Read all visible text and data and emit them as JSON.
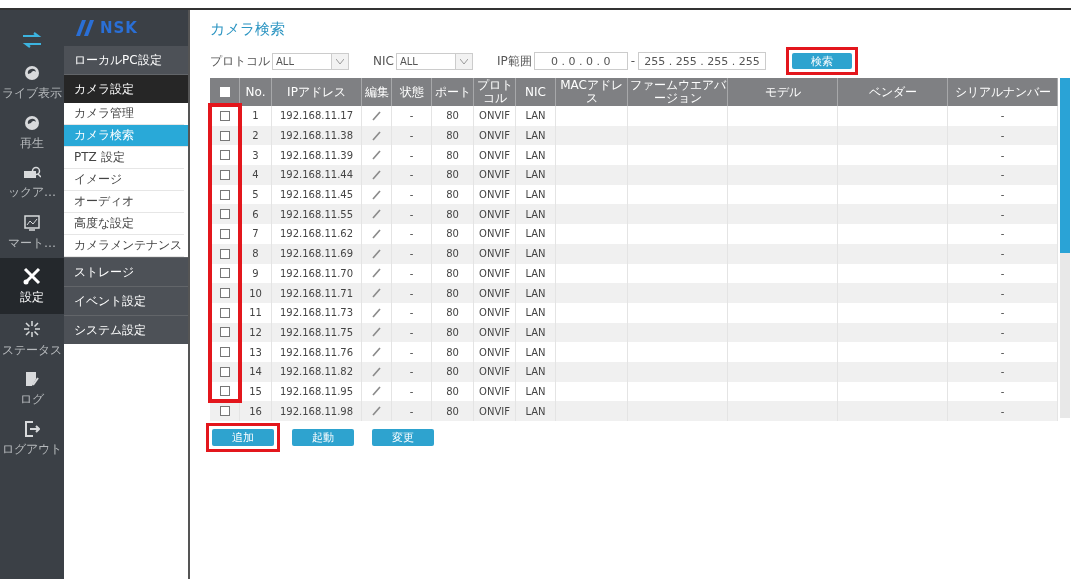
{
  "nav_bar": [
    {
      "selected": false
    },
    {
      "label": "ライブ表示",
      "selected": false
    },
    {
      "label": "再生",
      "selected": false
    },
    {
      "label": "ックア…",
      "selected": false
    },
    {
      "label": "マート…",
      "selected": false
    },
    {
      "label": "設定",
      "selected": true
    },
    {
      "label": "ステータス",
      "selected": false
    },
    {
      "label": "ログ",
      "selected": false
    },
    {
      "label": "ログアウト",
      "selected": false
    }
  ],
  "logo": {
    "text": "NSK"
  },
  "menu": [
    {
      "label": "ローカルPC設定",
      "selected": false
    },
    {
      "label": "カメラ設定",
      "selected": true,
      "children": [
        {
          "label": "カメラ管理",
          "selected": false
        },
        {
          "label": "カメラ検索",
          "selected": true
        },
        {
          "label": "PTZ 設定",
          "selected": false
        },
        {
          "label": "イメージ",
          "selected": false
        },
        {
          "label": "オーディオ",
          "selected": false
        },
        {
          "label": "高度な設定",
          "selected": false
        },
        {
          "label": "カメラメンテナンス",
          "selected": false
        }
      ]
    },
    {
      "label": "ストレージ",
      "selected": false
    },
    {
      "label": "イベント設定",
      "selected": false
    },
    {
      "label": "システム設定",
      "selected": false
    }
  ],
  "page_title": "カメラ検索",
  "filters": {
    "protocol_label": "プロトコル",
    "protocol": "ALL",
    "nic_label": "NIC",
    "nic": "ALL",
    "ip_label": "IP範囲",
    "ip_start": "0 . 0 . 0 . 0",
    "ip_separator": "-",
    "ip_end": "255 . 255 . 255 . 255"
  },
  "search_button": {
    "label": "検索",
    "highlighted": true
  },
  "table": {
    "checkbox_column_highlighted": true,
    "select_all_checked": false,
    "columns": [
      "No.",
      "IPアドレス",
      "編集",
      "状態",
      "ポート",
      "プロトコル",
      "NIC",
      "MACアドレス",
      "ファームウエアバージョン",
      "モデル",
      "ベンダー",
      "シリアルナンバー"
    ],
    "rows": [
      {
        "checked": false,
        "no": "1",
        "ip": "192.168.11.17",
        "status": "-",
        "port": "80",
        "protocol": "ONVIF",
        "nic": "LAN",
        "serial": "-"
      },
      {
        "checked": false,
        "no": "2",
        "ip": "192.168.11.38",
        "status": "-",
        "port": "80",
        "protocol": "ONVIF",
        "nic": "LAN",
        "serial": "-"
      },
      {
        "checked": false,
        "no": "3",
        "ip": "192.168.11.39",
        "status": "-",
        "port": "80",
        "protocol": "ONVIF",
        "nic": "LAN",
        "serial": "-"
      },
      {
        "checked": false,
        "no": "4",
        "ip": "192.168.11.44",
        "status": "-",
        "port": "80",
        "protocol": "ONVIF",
        "nic": "LAN",
        "serial": "-"
      },
      {
        "checked": false,
        "no": "5",
        "ip": "192.168.11.45",
        "status": "-",
        "port": "80",
        "protocol": "ONVIF",
        "nic": "LAN",
        "serial": "-"
      },
      {
        "checked": false,
        "no": "6",
        "ip": "192.168.11.55",
        "status": "-",
        "port": "80",
        "protocol": "ONVIF",
        "nic": "LAN",
        "serial": "-"
      },
      {
        "checked": false,
        "no": "7",
        "ip": "192.168.11.62",
        "status": "-",
        "port": "80",
        "protocol": "ONVIF",
        "nic": "LAN",
        "serial": "-"
      },
      {
        "checked": false,
        "no": "8",
        "ip": "192.168.11.69",
        "status": "-",
        "port": "80",
        "protocol": "ONVIF",
        "nic": "LAN",
        "serial": "-"
      },
      {
        "checked": false,
        "no": "9",
        "ip": "192.168.11.70",
        "status": "-",
        "port": "80",
        "protocol": "ONVIF",
        "nic": "LAN",
        "serial": "-"
      },
      {
        "checked": false,
        "no": "10",
        "ip": "192.168.11.71",
        "status": "-",
        "port": "80",
        "protocol": "ONVIF",
        "nic": "LAN",
        "serial": "-"
      },
      {
        "checked": false,
        "no": "11",
        "ip": "192.168.11.73",
        "status": "-",
        "port": "80",
        "protocol": "ONVIF",
        "nic": "LAN",
        "serial": "-"
      },
      {
        "checked": false,
        "no": "12",
        "ip": "192.168.11.75",
        "status": "-",
        "port": "80",
        "protocol": "ONVIF",
        "nic": "LAN",
        "serial": "-"
      },
      {
        "checked": false,
        "no": "13",
        "ip": "192.168.11.76",
        "status": "-",
        "port": "80",
        "protocol": "ONVIF",
        "nic": "LAN",
        "serial": "-"
      },
      {
        "checked": false,
        "no": "14",
        "ip": "192.168.11.82",
        "status": "-",
        "port": "80",
        "protocol": "ONVIF",
        "nic": "LAN",
        "serial": "-"
      },
      {
        "checked": false,
        "no": "15",
        "ip": "192.168.11.95",
        "status": "-",
        "port": "80",
        "protocol": "ONVIF",
        "nic": "LAN",
        "serial": "-"
      },
      {
        "checked": false,
        "no": "16",
        "ip": "192.168.11.98",
        "status": "-",
        "port": "80",
        "protocol": "ONVIF",
        "nic": "LAN",
        "serial": "-"
      }
    ]
  },
  "actions": [
    {
      "label": "追加",
      "highlighted": true
    },
    {
      "label": "起動",
      "highlighted": false
    },
    {
      "label": "変更",
      "highlighted": false
    }
  ]
}
